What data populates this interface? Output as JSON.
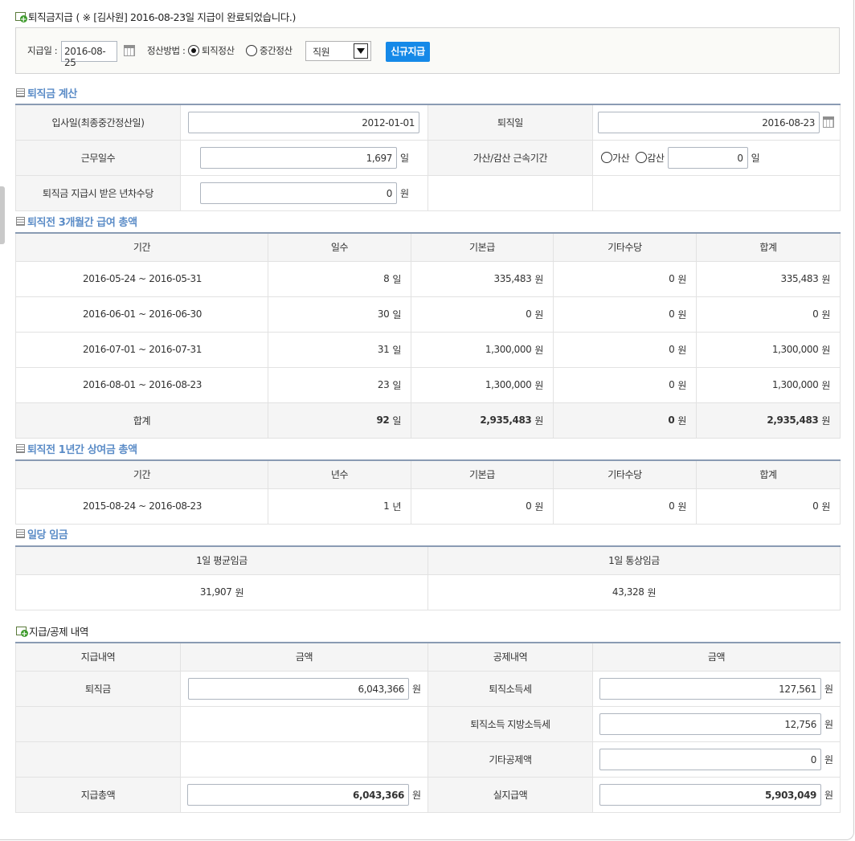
{
  "header": {
    "title": "퇴직금지급",
    "notice": "( ※ [김사원] 2016-08-23일  지급이 완료되었습니다.)"
  },
  "search": {
    "pay_date_label": "지급일 :",
    "pay_date": "2016-08-25",
    "method_label": "정산방법 :",
    "method_options": [
      "퇴직정산",
      "중간정산"
    ],
    "method_selected": "퇴직정산",
    "position_selected": "직원",
    "new_button": "신규지급"
  },
  "calc": {
    "title": "퇴직금 계산",
    "join_date_label": "입사일(최종중간정산일)",
    "join_date": "2012-01-01",
    "retire_date_label": "퇴직일",
    "retire_date": "2016-08-23",
    "work_days_label": "근무일수",
    "work_days": "1,697",
    "work_days_unit": "일",
    "adjust_label": "가산/감산 근속기간",
    "adjust_options": [
      "가산",
      "감산"
    ],
    "adjust_value": "0",
    "adjust_unit": "일",
    "leave_allow_label": "퇴직금 지급시 받은 년차수당",
    "leave_allow": "0",
    "leave_allow_unit": "원"
  },
  "salary3m": {
    "title": "퇴직전 3개월간 급여 총액",
    "headers": [
      "기간",
      "일수",
      "기본급",
      "기타수당",
      "합계"
    ],
    "rows": [
      {
        "period": "2016-05-24 ~ 2016-05-31",
        "days": "8",
        "base": "335,483",
        "etc": "0",
        "total": "335,483"
      },
      {
        "period": "2016-06-01 ~ 2016-06-30",
        "days": "30",
        "base": "0",
        "etc": "0",
        "total": "0"
      },
      {
        "period": "2016-07-01 ~ 2016-07-31",
        "days": "31",
        "base": "1,300,000",
        "etc": "0",
        "total": "1,300,000"
      },
      {
        "period": "2016-08-01 ~ 2016-08-23",
        "days": "23",
        "base": "1,300,000",
        "etc": "0",
        "total": "1,300,000"
      }
    ],
    "sum": {
      "label": "합계",
      "days": "92",
      "base": "2,935,483",
      "etc": "0",
      "total": "2,935,483"
    },
    "day_unit": "일",
    "won_unit": "원"
  },
  "bonus1y": {
    "title": "퇴직전 1년간 상여금 총액",
    "headers": [
      "기간",
      "년수",
      "기본급",
      "기타수당",
      "합계"
    ],
    "row": {
      "period": "2015-08-24 ~ 2016-08-23",
      "years": "1",
      "base": "0",
      "etc": "0",
      "total": "0"
    },
    "year_unit": "년",
    "won_unit": "원"
  },
  "daily": {
    "title": "일당 임금",
    "headers": [
      "1일 평균임금",
      "1일 통상임금"
    ],
    "avg": "31,907",
    "ordinary": "43,328",
    "won_unit": "원"
  },
  "payment": {
    "title": "지급/공제 내역",
    "headers": [
      "지급내역",
      "금액",
      "공제내역",
      "금액"
    ],
    "severance_label": "퇴직금",
    "severance": "6,043,366",
    "income_tax_label": "퇴직소득세",
    "income_tax": "127,561",
    "local_tax_label": "퇴직소득 지방소득세",
    "local_tax": "12,756",
    "other_deduct_label": "기타공제액",
    "other_deduct": "0",
    "total_pay_label": "지급총액",
    "total_pay": "6,043,366",
    "net_pay_label": "실지급액",
    "net_pay": "5,903,049",
    "won_unit": "원"
  }
}
